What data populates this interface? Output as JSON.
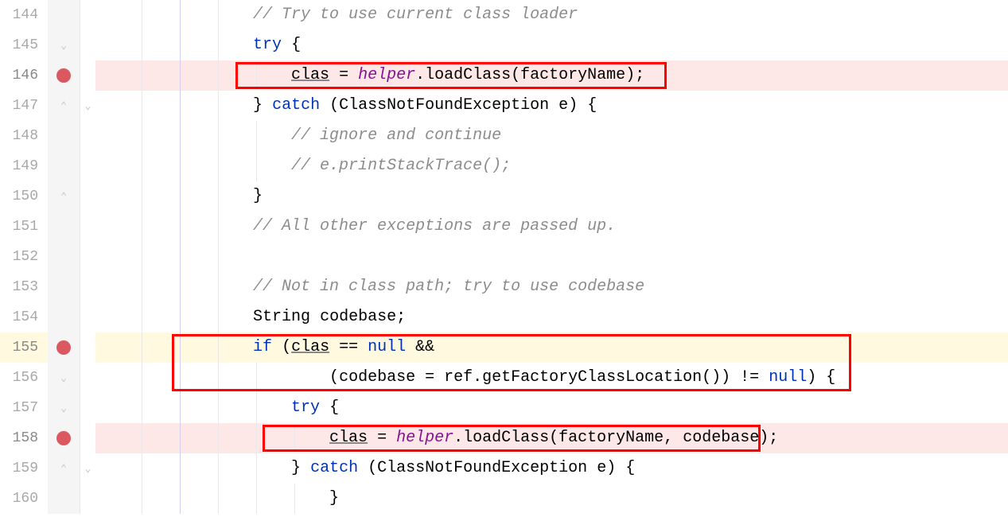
{
  "lines": {
    "144": {
      "num": "144"
    },
    "145": {
      "num": "145"
    },
    "146": {
      "num": "146"
    },
    "147": {
      "num": "147"
    },
    "148": {
      "num": "148"
    },
    "149": {
      "num": "149"
    },
    "150": {
      "num": "150"
    },
    "151": {
      "num": "151"
    },
    "152": {
      "num": "152"
    },
    "153": {
      "num": "153"
    },
    "154": {
      "num": "154"
    },
    "155": {
      "num": "155"
    },
    "156": {
      "num": "156"
    },
    "157": {
      "num": "157"
    },
    "158": {
      "num": "158"
    },
    "159": {
      "num": "159"
    },
    "160": {
      "num": "160"
    }
  },
  "code": {
    "l144": {
      "comment": "// Try to use current class loader"
    },
    "l145": {
      "try": "try",
      "space": " ",
      "brace": "{"
    },
    "l146": {
      "clas": "clas",
      "eq": " = ",
      "helper": "helper",
      "dot": ".",
      "method": "loadClass",
      "op": "(",
      "arg": "factoryName",
      "cp": ")",
      "semi": ";"
    },
    "l147": {
      "cbrace": "}",
      "sp": " ",
      "catch": "catch",
      "sp2": " ",
      "op": "(",
      "type": "ClassNotFoundException",
      "sp3": " ",
      "var": "e",
      "cp": ")",
      "sp4": " ",
      "obrace": "{"
    },
    "l148": {
      "comment": "// ignore and continue"
    },
    "l149": {
      "comment": "// e.printStackTrace();"
    },
    "l150": {
      "cbrace": "}"
    },
    "l151": {
      "comment": "// All other exceptions are passed up."
    },
    "l152": {
      "blank": ""
    },
    "l153": {
      "comment": "// Not in class path; try to use codebase"
    },
    "l154": {
      "type": "String",
      "sp": " ",
      "var": "codebase",
      "semi": ";"
    },
    "l155": {
      "if": "if",
      "sp": " ",
      "op": "(",
      "clas": "clas",
      "sp2": " == ",
      "null": "null",
      "sp3": " ",
      "amp": "&&"
    },
    "l156": {
      "op": "(",
      "var": "codebase",
      "eq": " = ",
      "ref": "ref",
      "dot": ".",
      "method": "getFactoryClassLocation",
      "pp": "()) != ",
      "null": "null",
      "cp": ")",
      "sp": " ",
      "brace": "{"
    },
    "l157": {
      "try": "try",
      "sp": " ",
      "brace": "{"
    },
    "l158": {
      "clas": "clas",
      "eq": " = ",
      "helper": "helper",
      "dot": ".",
      "method": "loadClass",
      "op": "(",
      "arg1": "factoryName",
      "comma": ", ",
      "arg2": "codebase",
      "cp": ")",
      "semi": ";"
    },
    "l159": {
      "cbrace": "}",
      "sp": " ",
      "catch": "catch",
      "sp2": " ",
      "op": "(",
      "type": "ClassNotFoundException",
      "sp3": " ",
      "var": "e",
      "cp": ")",
      "sp4": " ",
      "obrace": "{"
    },
    "l160": {
      "cbrace": "}"
    }
  },
  "indent": {
    "base": "            ",
    "one": "                ",
    "two": "                    ",
    "ifcont": "                    ",
    "three": "                        "
  }
}
